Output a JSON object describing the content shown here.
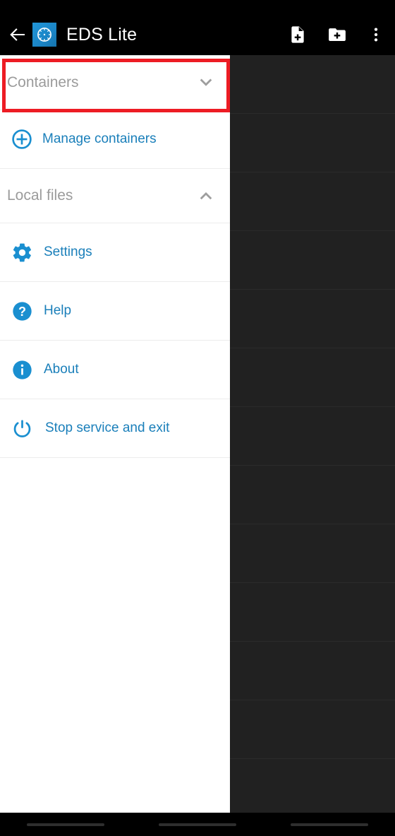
{
  "app": {
    "title": "EDS Lite",
    "logo_icon": "clock-compass-icon",
    "accent_color": "#1a8fd0",
    "highlight_color": "#ed1c24"
  },
  "app_bar": {
    "back_icon": "back-arrow-icon",
    "actions": [
      {
        "name": "new-file-button",
        "icon": "file-plus-icon",
        "label": "New file"
      },
      {
        "name": "new-folder-button",
        "icon": "folder-plus-icon",
        "label": "New folder"
      },
      {
        "name": "overflow-button",
        "icon": "more-vertical-icon",
        "label": "More options"
      }
    ]
  },
  "drawer": {
    "sections": [
      {
        "name": "containers",
        "label": "Containers",
        "chevron_icon": "chevron-down-icon",
        "expanded": false,
        "highlighted": true
      },
      {
        "name": "local-files",
        "label": "Local files",
        "chevron_icon": "chevron-up-icon",
        "expanded": true,
        "highlighted": false
      }
    ],
    "items": [
      {
        "name": "manage-containers",
        "label": "Manage containers",
        "icon": "plus-circle-outline-icon"
      },
      {
        "name": "settings",
        "label": "Settings",
        "icon": "gear-icon"
      },
      {
        "name": "help",
        "label": "Help",
        "icon": "question-circle-icon"
      },
      {
        "name": "about",
        "label": "About",
        "icon": "info-circle-icon"
      },
      {
        "name": "stop-service",
        "label": "Stop service and exit",
        "icon": "power-icon"
      }
    ]
  },
  "bottom_nav": {
    "hints": [
      "nav-hint-left",
      "nav-hint-center",
      "nav-hint-right"
    ]
  }
}
